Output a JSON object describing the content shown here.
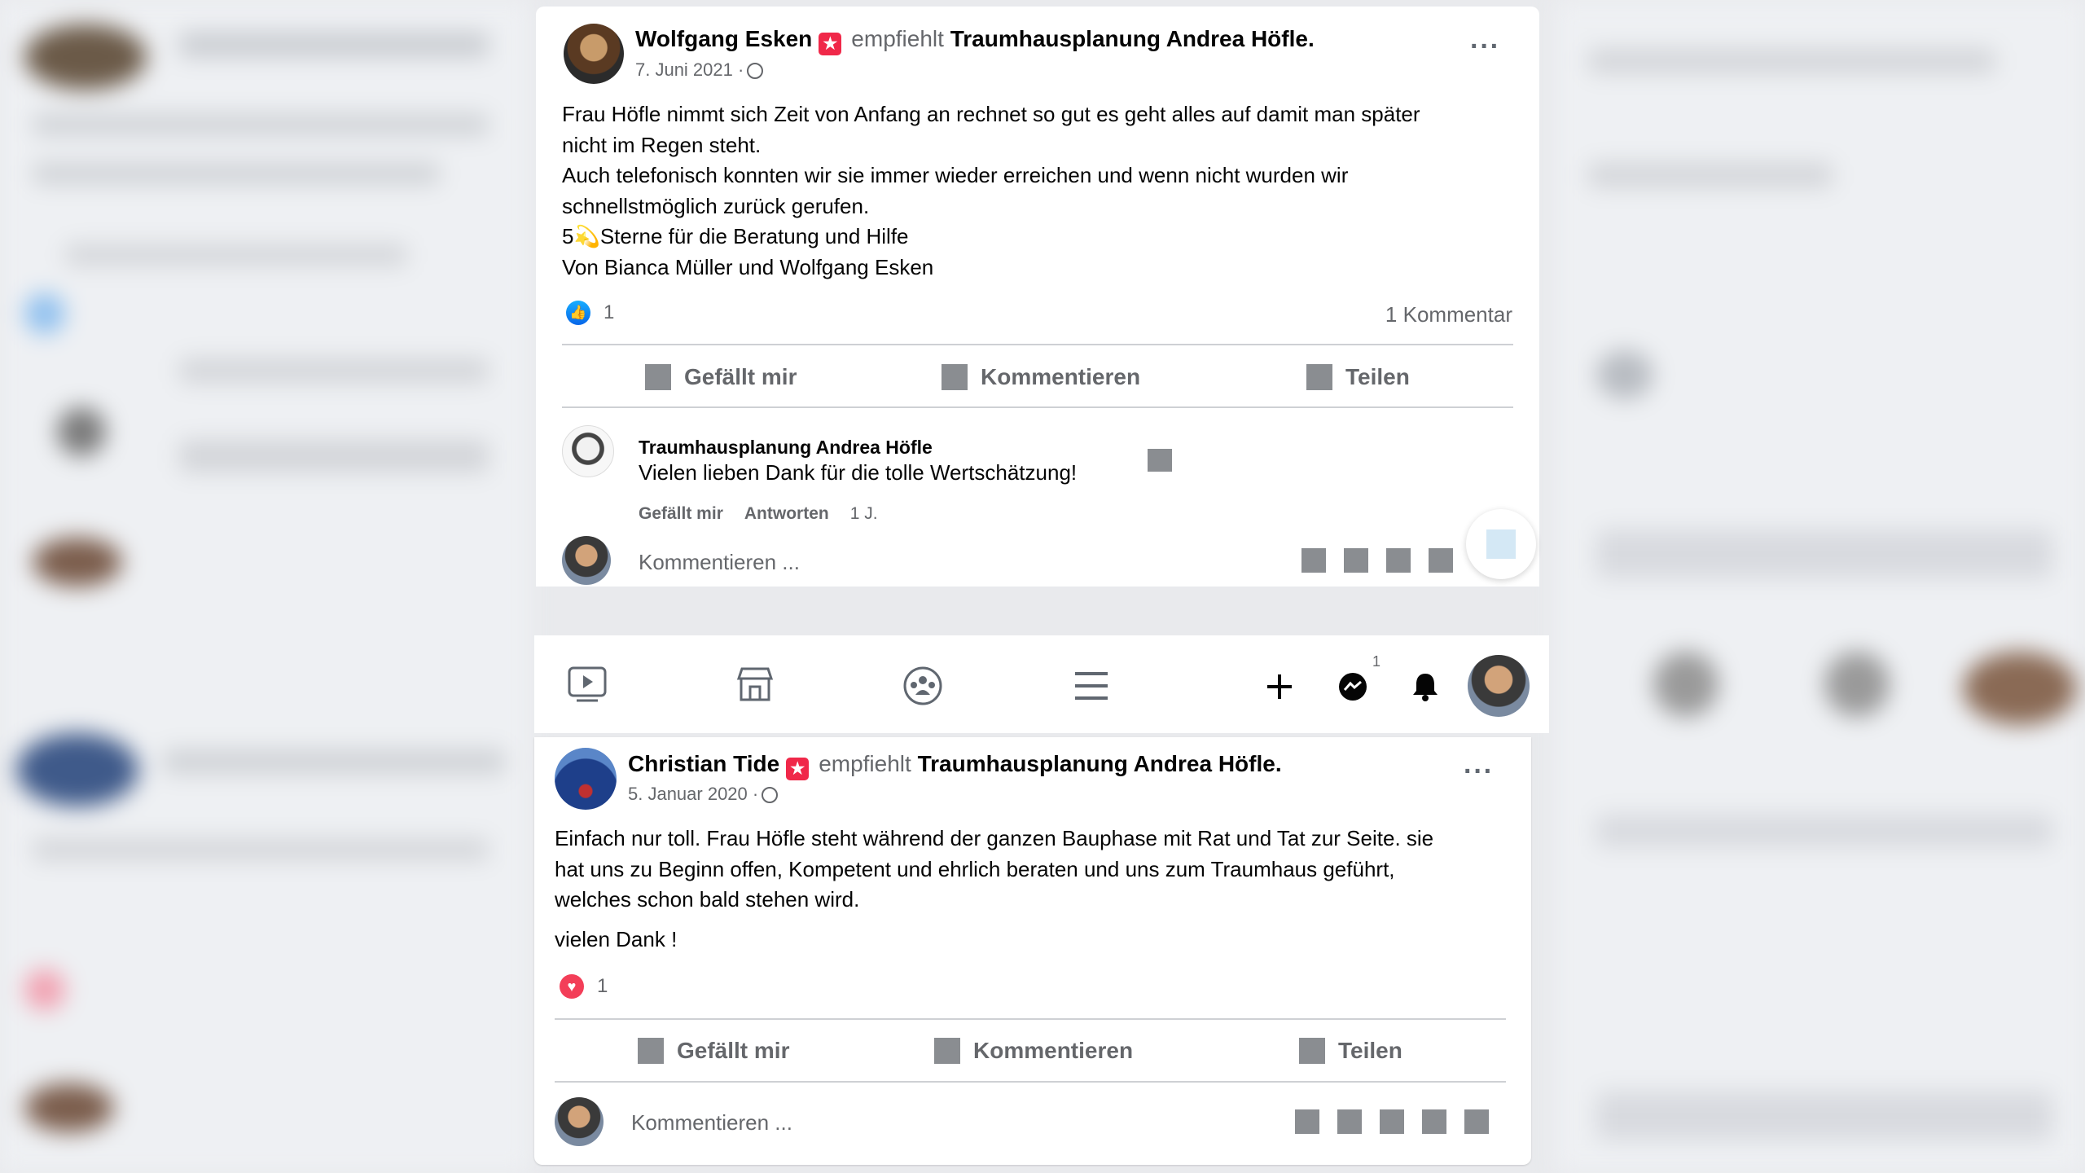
{
  "post1": {
    "author": "Wolfgang Esken",
    "recommends": "empfiehlt",
    "page": "Traumhausplanung Andrea Höfle.",
    "date": "7. Juni 2021 ·",
    "more_icon": "more-dots-icon",
    "text_lines": [
      "Frau Höfle nimmt sich Zeit von Anfang an rechnet so gut es geht alles auf damit man später",
      "nicht im Regen steht.",
      "Auch telefonisch konnten wir sie immer wieder erreichen und wenn nicht wurden wir",
      "schnellstmöglich zurück gerufen.",
      "5💫Sterne für die Beratung und Hilfe",
      "Von Bianca Müller und Wolfgang Esken"
    ],
    "reaction_count": "1",
    "comment_count": "1 Kommentar",
    "actions": {
      "like": "Gefällt mir",
      "comment": "Kommentieren",
      "share": "Teilen"
    },
    "comment": {
      "author": "Traumhausplanung Andrea Höfle",
      "text": "Vielen lieben Dank für die tolle Wertschätzung!",
      "like": "Gefällt mir",
      "reply": "Antworten",
      "time": "1 J."
    },
    "input_placeholder": "Kommentieren ..."
  },
  "navbar": {
    "icons": [
      "video-icon",
      "marketplace-icon",
      "groups-icon",
      "menu-icon",
      "plus-icon",
      "messenger-icon",
      "bell-icon",
      "profile-avatar"
    ],
    "messenger_badge": "1"
  },
  "post2": {
    "author": "Christian Tide",
    "recommends": "empfiehlt",
    "page": "Traumhausplanung Andrea Höfle.",
    "date": "5. Januar 2020 ·",
    "text_lines": [
      "Einfach nur toll. Frau Höfle steht während der ganzen Bauphase mit Rat und Tat zur Seite. sie",
      "hat uns zu Beginn offen, Kompetent und ehrlich beraten und uns zum Traumhaus geführt,",
      "welches schon bald stehen wird.",
      "vielen Dank !"
    ],
    "reaction_count": "1",
    "actions": {
      "like": "Gefällt mir",
      "comment": "Kommentieren",
      "share": "Teilen"
    },
    "input_placeholder": "Kommentieren ..."
  },
  "colors": {
    "accent": "#1877f2",
    "recommend_badge": "#f02849",
    "secondary_text": "#65676b"
  }
}
